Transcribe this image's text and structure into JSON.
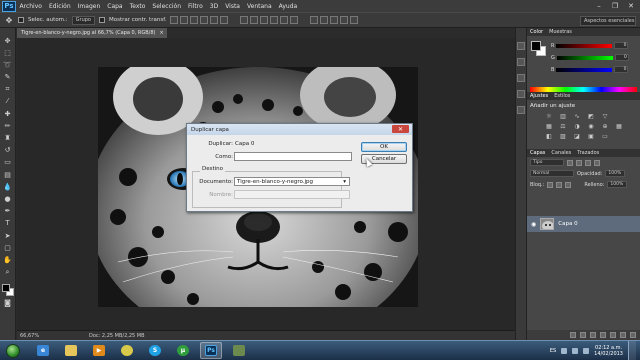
{
  "app": {
    "logo": "Ps",
    "menu": [
      "Archivo",
      "Edición",
      "Imagen",
      "Capa",
      "Texto",
      "Selección",
      "Filtro",
      "3D",
      "Vista",
      "Ventana",
      "Ayuda"
    ],
    "window_controls": [
      "–",
      "❐",
      "✕"
    ]
  },
  "options": {
    "auto_select_label": "Selec. autom.:",
    "auto_select_value": "Grupo",
    "show_transform_label": "Mostrar contr. transf.",
    "workspace": "Aspectos esenciales"
  },
  "document": {
    "tab_title": "Tigre-en-blanco-y-negro.jpg al 66,7% (Capa 0, RGB/8)",
    "tab_close": "×",
    "zoom": "66,67%",
    "doc_size": "Doc: 2,25 MB/2,25 MB"
  },
  "dialog": {
    "title": "Duplicar capa",
    "close": "✕",
    "duplicate_label": "Duplicar:",
    "duplicate_value": "Capa 0",
    "as_label": "Como:",
    "as_value": "",
    "destination_legend": "Destino",
    "document_label": "Documento:",
    "document_value": "Tigre-en-blanco-y-negro.jpg",
    "name_label": "Nombre:",
    "ok_label": "OK",
    "cancel_label": "Cancelar"
  },
  "panels": {
    "color_tabs": [
      "Color",
      "Muestras"
    ],
    "sliders": [
      {
        "channel": "R",
        "value": "0"
      },
      {
        "channel": "G",
        "value": "0"
      },
      {
        "channel": "B",
        "value": "0"
      }
    ],
    "adjust_tabs": [
      "Ajustes",
      "Estilos"
    ],
    "adjust_title": "Añadir un ajuste",
    "layer_tabs": [
      "Capas",
      "Canales",
      "Trazados"
    ],
    "kind_filter": "Tipo",
    "blend_mode": "Normal",
    "opacity_label": "Opacidad:",
    "opacity_value": "100%",
    "lock_label": "Bloq.:",
    "fill_label": "Relleno:",
    "fill_value": "100%",
    "layer_name": "Capa 0"
  },
  "taskbar": {
    "tray_lang": "ES",
    "time": "02:12 a.m.",
    "date": "14/02/2013"
  }
}
